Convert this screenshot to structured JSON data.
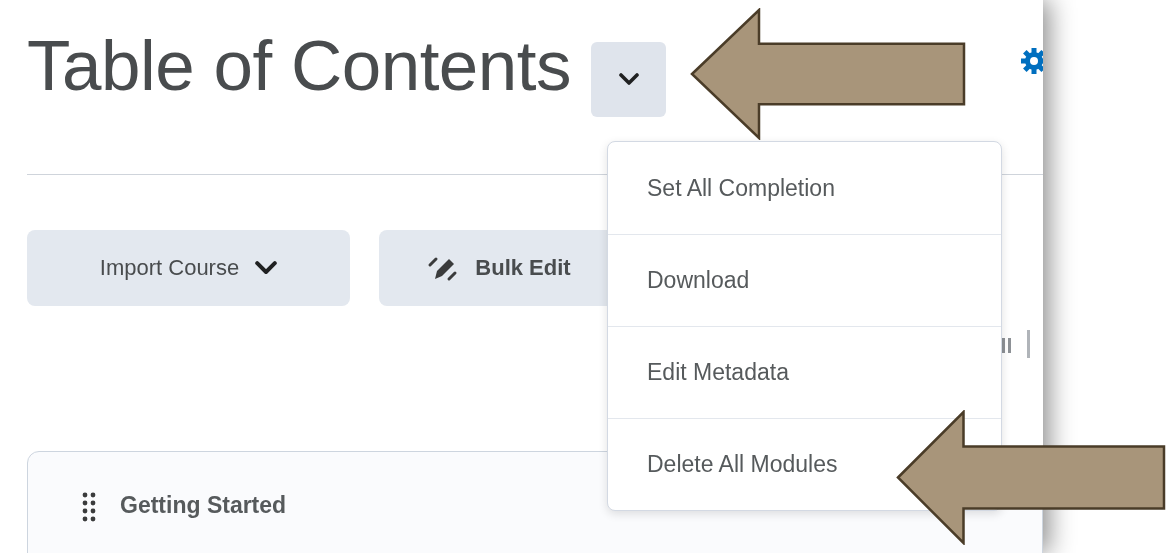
{
  "page": {
    "title": "Table of Contents"
  },
  "toolbar": {
    "buttons": [
      {
        "label": "Import Course",
        "kind": "dropdown"
      },
      {
        "label": "Bulk Edit",
        "kind": "edit"
      }
    ]
  },
  "menu": {
    "expanded": true,
    "items": [
      {
        "label": "Set All Completion"
      },
      {
        "label": "Download"
      },
      {
        "label": "Edit Metadata"
      },
      {
        "label": "Delete All Modules"
      }
    ]
  },
  "modules": [
    {
      "title": "Getting Started"
    }
  ]
}
